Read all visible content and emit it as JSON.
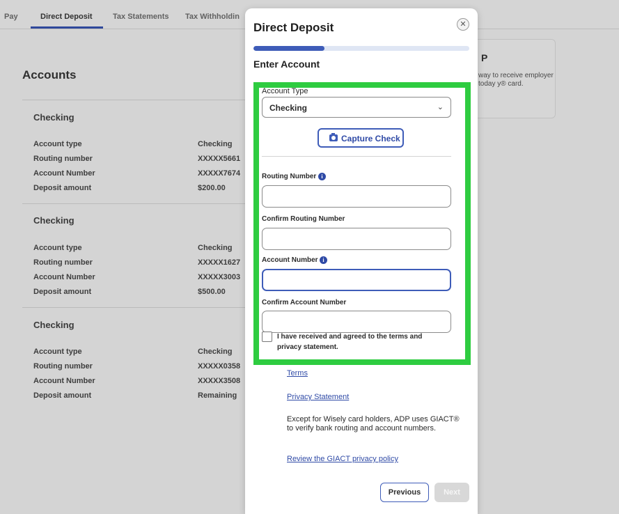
{
  "nav": {
    "tabs": [
      {
        "label": "Pay"
      },
      {
        "label": "Direct Deposit"
      },
      {
        "label": "Tax Statements"
      },
      {
        "label": "Tax Withholdin"
      }
    ]
  },
  "accounts": {
    "title": "Accounts",
    "groups": [
      {
        "heading": "Checking",
        "rows": [
          {
            "label": "Account type",
            "value": "Checking"
          },
          {
            "label": "Routing number",
            "value": "XXXXX5661"
          },
          {
            "label": "Account Number",
            "value": "XXXXX7674"
          },
          {
            "label": "Deposit amount",
            "value": "$200.00"
          }
        ]
      },
      {
        "heading": "Checking",
        "rows": [
          {
            "label": "Account type",
            "value": "Checking"
          },
          {
            "label": "Routing number",
            "value": "XXXXX1627"
          },
          {
            "label": "Account Number",
            "value": "XXXXX3003"
          },
          {
            "label": "Deposit amount",
            "value": "$500.00"
          }
        ]
      },
      {
        "heading": "Checking",
        "rows": [
          {
            "label": "Account type",
            "value": "Checking"
          },
          {
            "label": "Routing number",
            "value": "XXXXX0358"
          },
          {
            "label": "Account Number",
            "value": "XXXXX3508"
          },
          {
            "label": "Deposit amount",
            "value": "Remaining"
          }
        ]
      }
    ]
  },
  "promo": {
    "title": "P",
    "text": "way to receive employer today y® card."
  },
  "modal": {
    "title": "Direct Deposit",
    "close_icon": "close-icon",
    "progress_fraction": 0.33,
    "step_title": "Enter Account",
    "account_type": {
      "label": "Account Type",
      "value": "Checking"
    },
    "capture_check_label": "Capture Check",
    "routing_number_label": "Routing Number",
    "confirm_routing_label": "Confirm Routing Number",
    "account_number_label": "Account Number",
    "confirm_account_label": "Confirm Account Number",
    "terms_checkbox_label": "I have received and agreed to the terms and privacy statement.",
    "terms_link": "Terms",
    "privacy_link": "Privacy Statement",
    "disclaimer": "Except for Wisely card holders, ADP uses GIACT® to verify bank routing and account numbers.",
    "giact_link": "Review the GIACT privacy policy",
    "previous_label": "Previous",
    "next_label": "Next"
  },
  "colors": {
    "accent": "#3e5cb8",
    "highlight": "#2ecc40",
    "disabled": "#d8d8d8"
  }
}
